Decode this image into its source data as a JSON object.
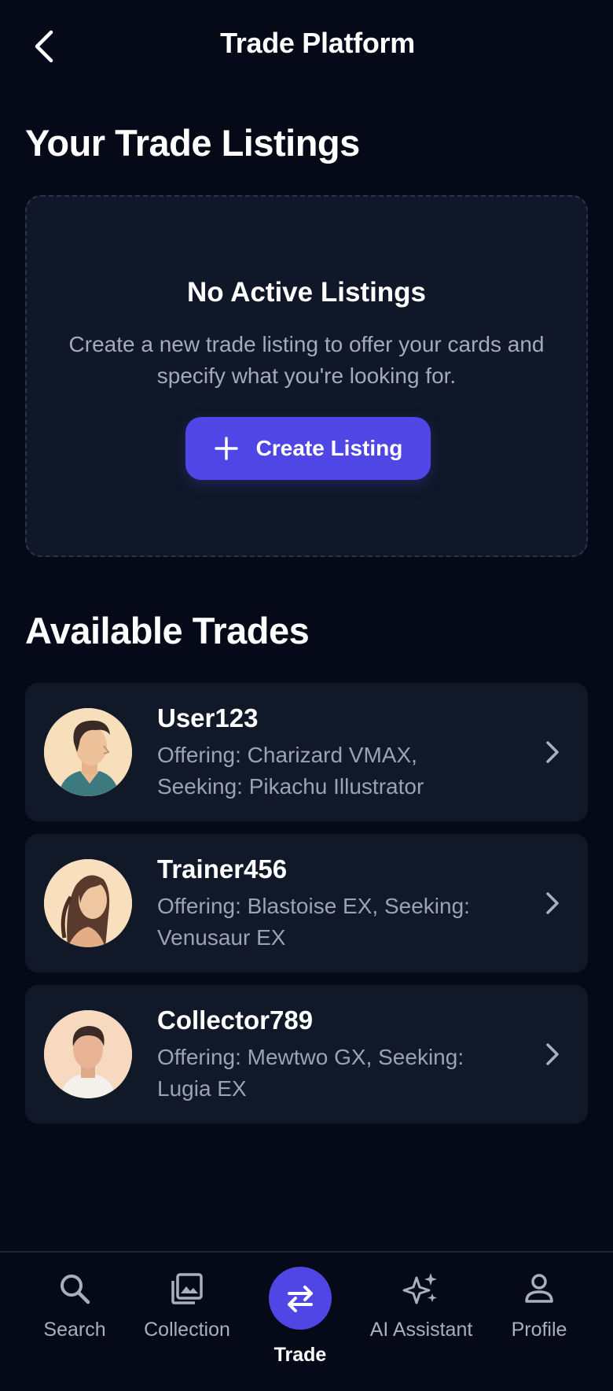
{
  "header": {
    "title": "Trade Platform",
    "back_icon": "chevron-left-icon"
  },
  "listings": {
    "section_title": "Your Trade Listings",
    "empty_title": "No Active Listings",
    "empty_description": "Create a new trade listing to offer your cards and specify what you're looking for.",
    "create_button_label": "Create Listing",
    "create_button_icon": "plus-icon"
  },
  "available": {
    "section_title": "Available Trades",
    "trades": [
      {
        "user": "User123",
        "description": "Offering: Charizard VMAX, Seeking: Pikachu Illustrator",
        "avatar": "man-avatar"
      },
      {
        "user": "Trainer456",
        "description": "Offering: Blastoise EX, Seeking: Venusaur EX",
        "avatar": "woman-avatar"
      },
      {
        "user": "Collector789",
        "description": "Offering: Mewtwo GX, Seeking: Lugia EX",
        "avatar": "man-avatar"
      }
    ]
  },
  "nav": {
    "items": [
      {
        "label": "Search",
        "icon": "search-icon"
      },
      {
        "label": "Collection",
        "icon": "collection-icon"
      },
      {
        "label": "Trade",
        "icon": "swap-icon",
        "active": true
      },
      {
        "label": "AI Assistant",
        "icon": "sparkles-icon"
      },
      {
        "label": "Profile",
        "icon": "person-icon"
      }
    ]
  },
  "colors": {
    "background": "#060a18",
    "card": "#111828",
    "accent": "#4f46e5",
    "muted_text": "#9aa3b3"
  }
}
